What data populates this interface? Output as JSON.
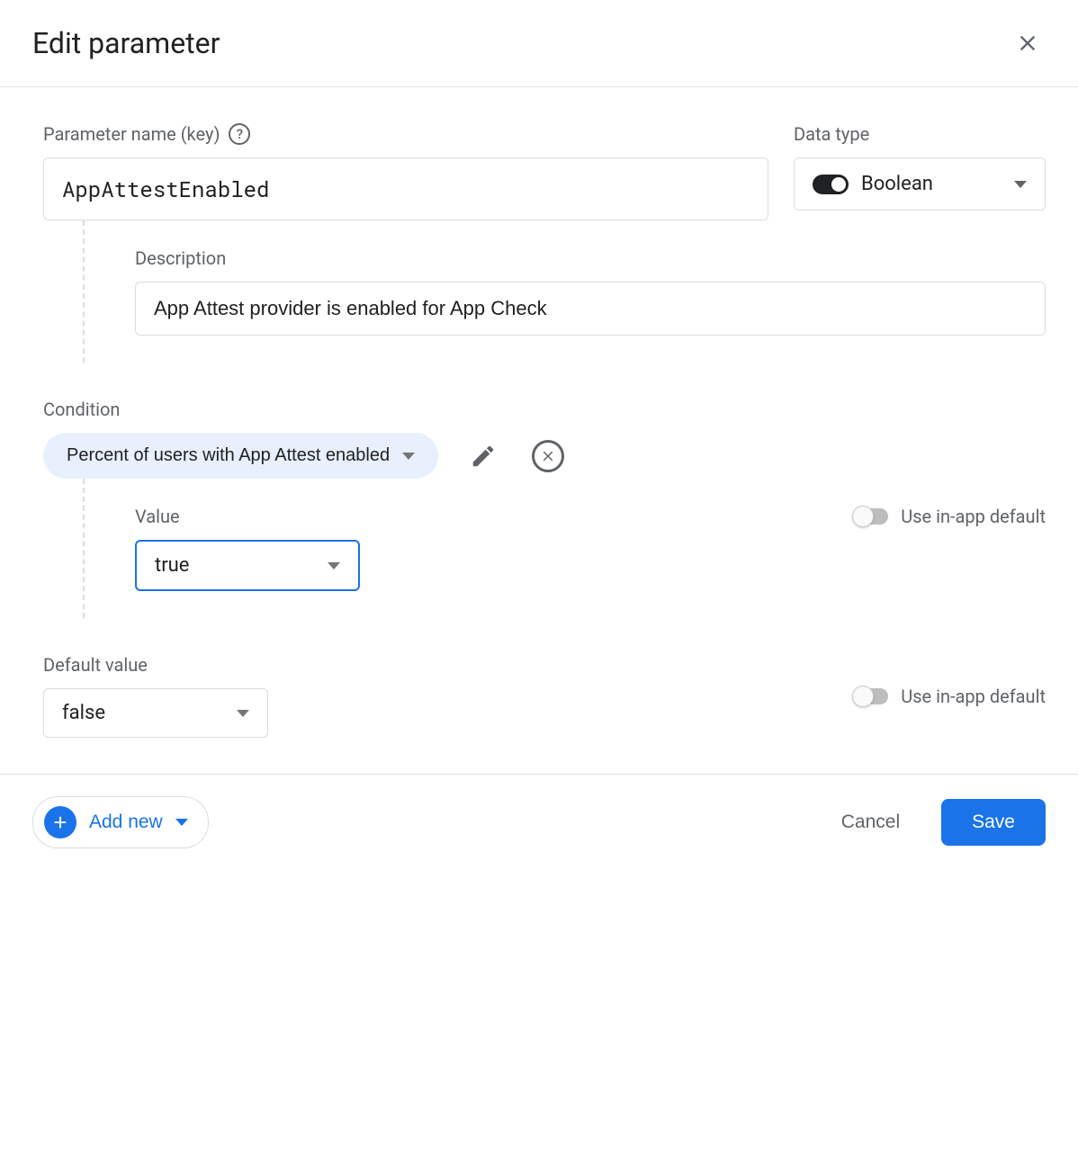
{
  "dialog": {
    "title": "Edit parameter"
  },
  "fields": {
    "paramNameLabel": "Parameter name (key)",
    "paramNameValue": "AppAttestEnabled",
    "dataTypeLabel": "Data type",
    "dataTypeValue": "Boolean",
    "descriptionLabel": "Description",
    "descriptionValue": "App Attest provider is enabled for App Check"
  },
  "condition": {
    "label": "Condition",
    "chipText": "Percent of users with App Attest enabled",
    "valueLabel": "Value",
    "valueSelected": "true",
    "useInAppDefaultLabel": "Use in-app default"
  },
  "defaultValue": {
    "label": "Default value",
    "selected": "false",
    "useInAppDefaultLabel": "Use in-app default"
  },
  "footer": {
    "addNew": "Add new",
    "cancel": "Cancel",
    "save": "Save"
  }
}
